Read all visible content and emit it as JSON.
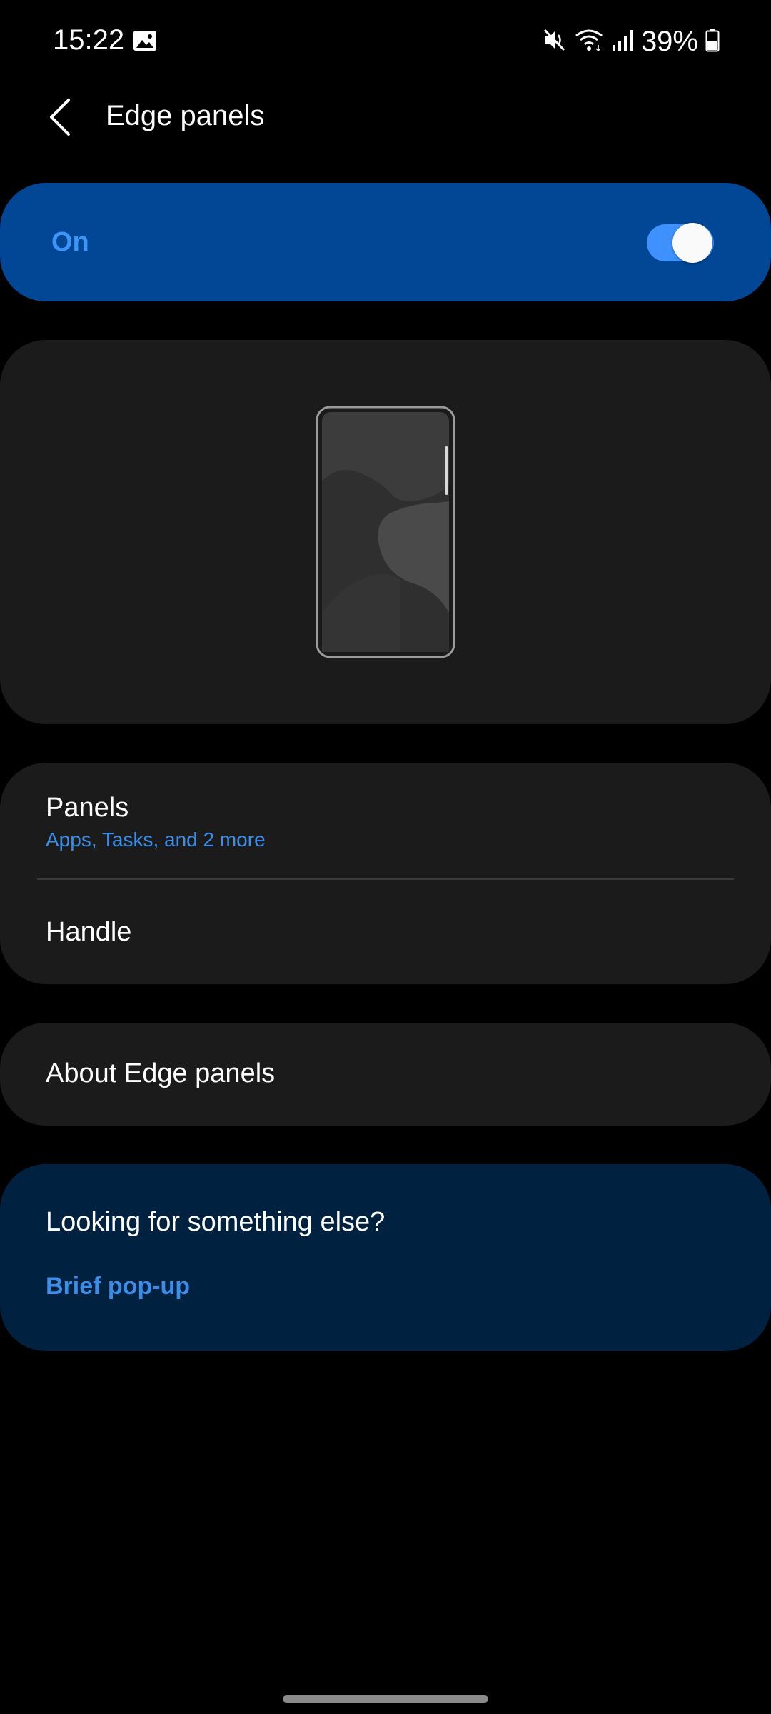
{
  "status_bar": {
    "time": "15:22",
    "battery": "39%",
    "icons": [
      "gallery-icon",
      "mute-icon",
      "wifi-icon",
      "signal-icon",
      "battery-icon"
    ]
  },
  "header": {
    "title": "Edge panels",
    "back_icon": "chevron-left-icon"
  },
  "master_switch": {
    "label": "On",
    "state": true,
    "accent": "#3e91ff",
    "card_color": "#014795"
  },
  "preview": {
    "illustration": "phone-edge-handle"
  },
  "settings_list": {
    "items": [
      {
        "title": "Panels",
        "subtitle": "Apps, Tasks, and 2 more"
      },
      {
        "title": "Handle"
      }
    ]
  },
  "about": {
    "title": "About Edge panels"
  },
  "suggestion": {
    "title": "Looking for something else?",
    "link": "Brief pop-up",
    "card_color": "#012140",
    "link_color": "#3d8de8"
  }
}
